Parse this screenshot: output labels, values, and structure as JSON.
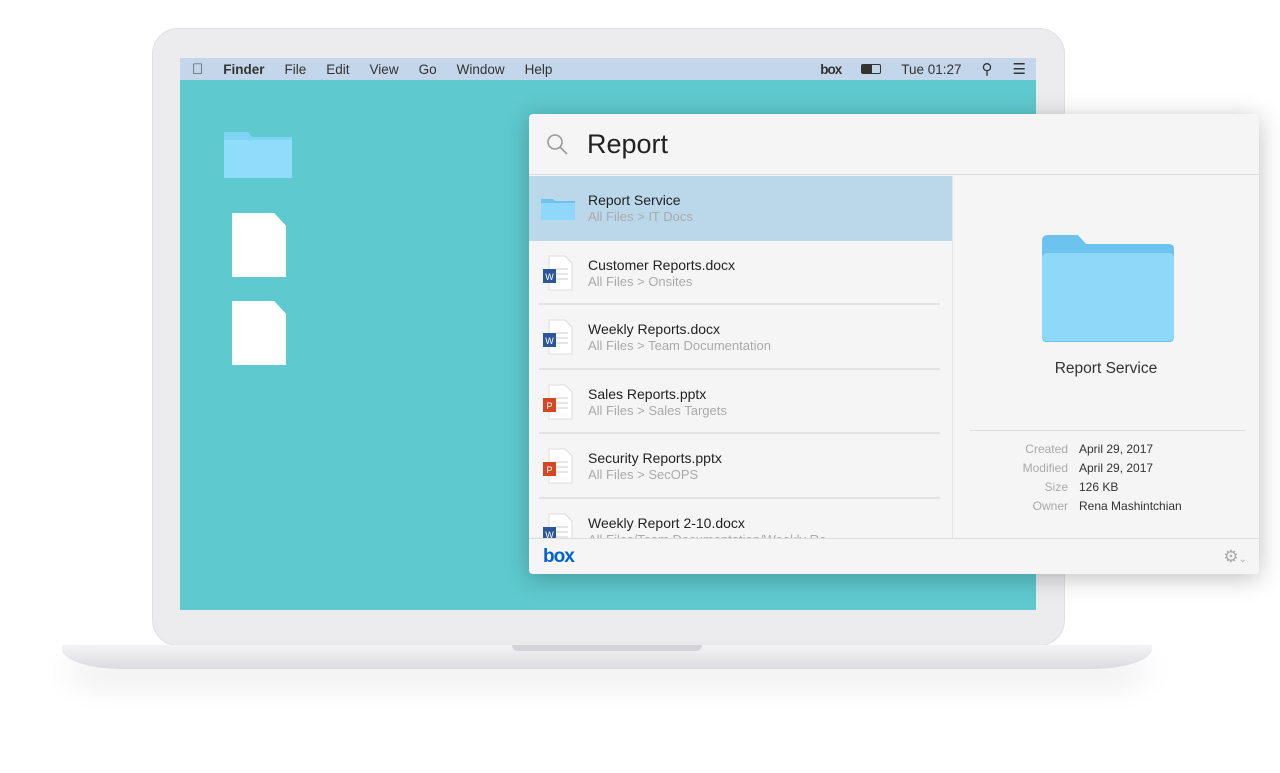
{
  "menubar": {
    "apple_icon": "apple-icon",
    "app": "Finder",
    "items": [
      "File",
      "Edit",
      "View",
      "Go",
      "Window",
      "Help"
    ],
    "box": "box",
    "time": "Tue 01:27",
    "battery_icon": "battery-icon",
    "search_icon": "search-icon",
    "list_icon": "list-icon"
  },
  "search": {
    "query": "Report"
  },
  "results": [
    {
      "name": "Report Service",
      "path": "All Files > IT Docs",
      "type": "folder",
      "selected": true
    },
    {
      "name": "Customer Reports.docx",
      "path": "All Files > Onsites",
      "type": "word"
    },
    {
      "name": "Weekly Reports.docx",
      "path": "All Files > Team Documentation",
      "type": "word"
    },
    {
      "name": "Sales Reports.pptx",
      "path": "All Files > Sales Targets",
      "type": "powerpoint"
    },
    {
      "name": "Security Reports.pptx",
      "path": "All Files > SecOPS",
      "type": "powerpoint"
    },
    {
      "name": "Weekly Report 2-10.docx",
      "path": "All Files/Team Documentation/Weekly Re",
      "type": "word"
    }
  ],
  "detail": {
    "name": "Report Service",
    "meta": [
      {
        "k": "Created",
        "v": "April 29, 2017"
      },
      {
        "k": "Modified",
        "v": "April 29, 2017"
      },
      {
        "k": "Size",
        "v": "126 KB"
      },
      {
        "k": "Owner",
        "v": "Rena Mashintchian"
      }
    ]
  },
  "footer": {
    "logo": "box"
  },
  "colors": {
    "desktop": "#5ec9cf",
    "selection": "#bad8ea",
    "brand": "#0061d5"
  }
}
